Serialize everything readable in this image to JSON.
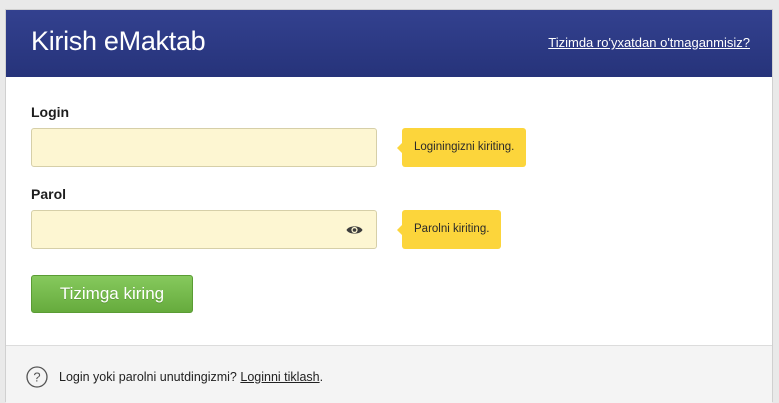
{
  "header": {
    "title": "Kirish eMaktab",
    "register_link": "Tizimda ro'yxatdan o'tmaganmisiz?"
  },
  "form": {
    "login": {
      "label": "Login",
      "value": "",
      "hint": "Loginingizni kiriting."
    },
    "password": {
      "label": "Parol",
      "value": "",
      "hint": "Parolni kiriting.",
      "toggle_icon": "eye-icon"
    },
    "submit_label": "Tizimga kiring"
  },
  "footer": {
    "icon": "help-circle-icon",
    "question": "Login yoki parolni unutdingizmi?",
    "reset_link": "Loginni tiklash",
    "suffix": "."
  },
  "colors": {
    "header": "#2c3a86",
    "input_bg": "#fdf6d2",
    "tooltip": "#fcd53b",
    "button": "#74b94a"
  }
}
